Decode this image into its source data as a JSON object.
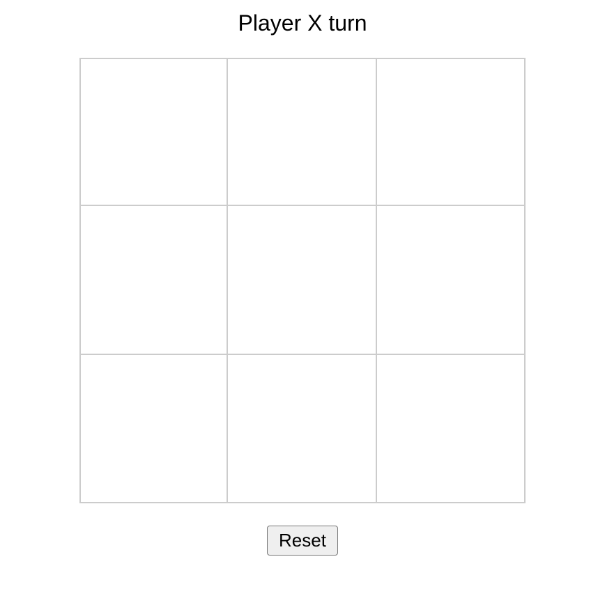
{
  "status": {
    "text": "Player X turn"
  },
  "board": {
    "cells": [
      "",
      "",
      "",
      "",
      "",
      "",
      "",
      "",
      ""
    ]
  },
  "controls": {
    "reset_label": "Reset"
  },
  "colors": {
    "cell_border": "#cccccc",
    "background": "#ffffff",
    "button_background": "#efefef",
    "button_border": "#767676"
  }
}
